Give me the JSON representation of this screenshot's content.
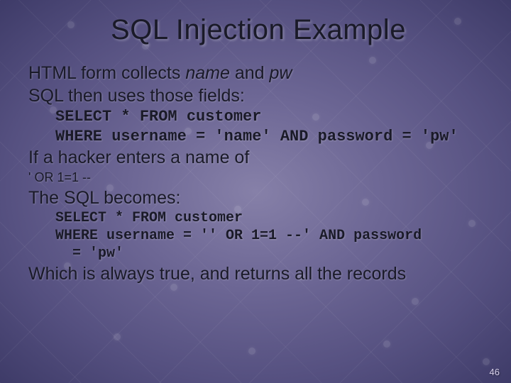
{
  "title": "SQL Injection Example",
  "line1a": "HTML form collects ",
  "line1b": "name",
  "line1c": " and ",
  "line1d": "pw",
  "line2": "SQL then uses those fields:",
  "code1_l1": "SELECT * FROM customer",
  "code1_l2": "WHERE username = 'name' AND password = 'pw'",
  "line3": "If a hacker enters a name of",
  "line4": "' OR 1=1 --",
  "line5": "The SQL becomes:",
  "code2_l1": "SELECT * FROM customer",
  "code2_l2": "WHERE username = '' OR 1=1 --' AND password",
  "code2_l3": "  = 'pw'",
  "line6": "Which is always true, and returns all the records",
  "page_number": "46"
}
